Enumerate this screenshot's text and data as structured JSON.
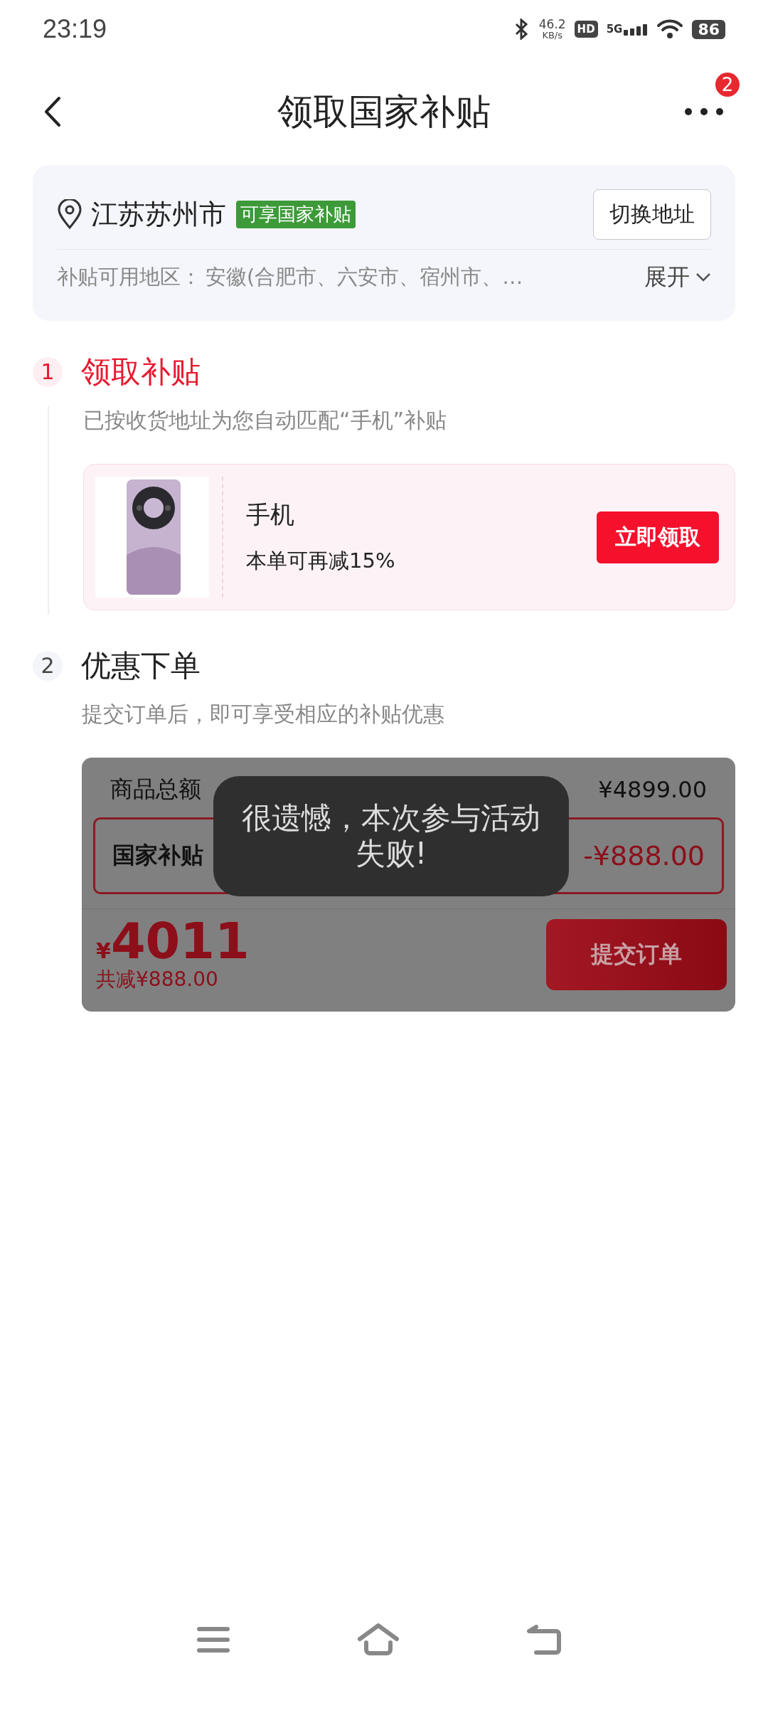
{
  "status_bar": {
    "time": "23:19",
    "net_speed": "46.2",
    "net_speed_unit": "KB/s",
    "hd": "HD",
    "network": "5G",
    "battery": "86"
  },
  "header": {
    "title": "领取国家补贴",
    "badge": "2"
  },
  "address": {
    "city": "江苏苏州市",
    "tag": "可享国家补贴",
    "switch_button": "切换地址",
    "regions_label": "补贴可用地区：",
    "regions": "安徽(合肥市、六安市、宿州市、…",
    "expand": "展开"
  },
  "steps": [
    {
      "number": "1",
      "title": "领取补贴",
      "active": true,
      "subtitle": "已按收货地址为您自动匹配“手机”补贴"
    },
    {
      "number": "2",
      "title": "优惠下单",
      "active": false,
      "subtitle": "提交订单后，即可享受相应的补贴优惠"
    }
  ],
  "coupon": {
    "name": "手机",
    "desc": "本单可再减15%",
    "button": "立即领取"
  },
  "order": {
    "dimmed": true,
    "rows": [
      {
        "label": "商品总额",
        "value": "¥4899.00",
        "highlighted": false
      },
      {
        "label": "国家补贴",
        "value": "-¥888.00",
        "highlighted": true
      }
    ],
    "currency": "¥",
    "total": "4011",
    "saved": "共减¥888.00",
    "submit": "提交订单"
  },
  "toast": "很遗憾，本次参与活动失败!"
}
